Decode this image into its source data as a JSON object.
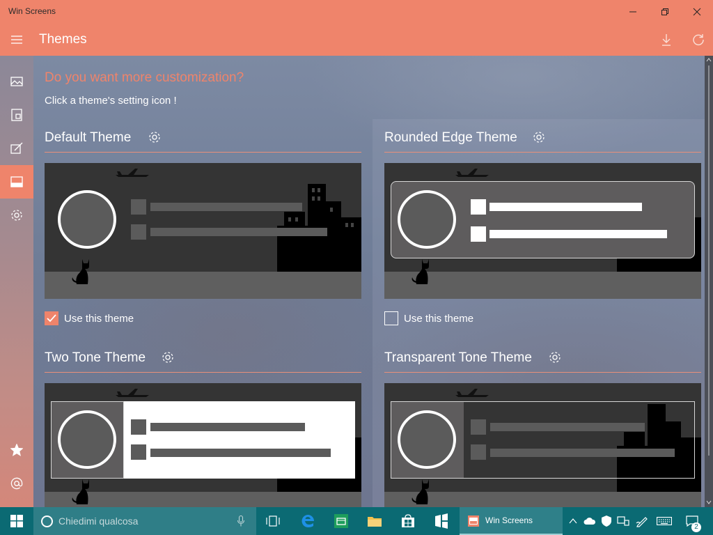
{
  "window": {
    "title": "Win Screens"
  },
  "header": {
    "title": "Themes"
  },
  "main": {
    "headline": "Do you want more customization?",
    "subline": "Click a theme's setting icon !",
    "themes": [
      {
        "title": "Default Theme",
        "checkbox_label": "Use this theme",
        "checked": true
      },
      {
        "title": "Rounded Edge Theme",
        "checkbox_label": "Use this theme",
        "checked": false
      },
      {
        "title": "Two Tone Theme"
      },
      {
        "title": "Transparent Tone Theme"
      }
    ]
  },
  "taskbar": {
    "search_placeholder": "Chiedimi qualcosa",
    "active_app": "Win Screens",
    "notification_count": "2"
  },
  "colors": {
    "accent": "#ef846b",
    "taskbar": "#0b6a73",
    "preview_dark": "#343434"
  }
}
